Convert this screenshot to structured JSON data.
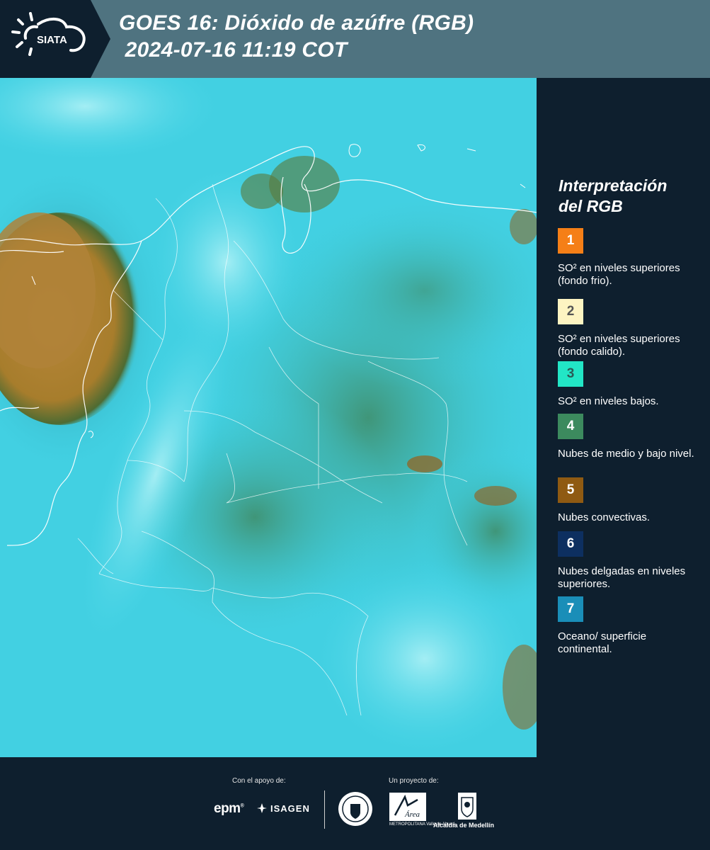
{
  "header": {
    "logo_text": "SIATA",
    "title_line1": "GOES 16: Dióxido de azúfre (RGB)",
    "title_line2": " 2024-07-16 11:19 COT"
  },
  "legend": {
    "title_line1": "Interpretación",
    "title_line2": "del RGB",
    "items": [
      {
        "number": "1",
        "color": "#f57f17",
        "number_color": "#ffffff",
        "label": "SO² en niveles superiores (fondo frio)."
      },
      {
        "number": "2",
        "color": "#fdf4c2",
        "number_color": "#555555",
        "label": "SO² en niveles superiores (fondo calido)."
      },
      {
        "number": "3",
        "color": "#22e6c6",
        "number_color": "#2b5a55",
        "label": "SO² en niveles bajos."
      },
      {
        "number": "4",
        "color": "#3c8a5e",
        "number_color": "#ffffff",
        "label": "Nubes de medio y bajo nivel."
      },
      {
        "number": "5",
        "color": "#8f5a12",
        "number_color": "#ffffff",
        "label": "Nubes convectivas."
      },
      {
        "number": "6",
        "color": "#0d2f60",
        "number_color": "#ffffff",
        "label": "Nubes delgadas en niveles superiores."
      },
      {
        "number": "7",
        "color": "#1a8eb8",
        "number_color": "#ffffff",
        "label": "Oceano/ superficie continental."
      }
    ]
  },
  "footer": {
    "support_label": "Con el apoyo de:",
    "project_label": "Un proyecto de:",
    "epm": "epm",
    "isagen": "ISAGEN",
    "amva_name": "Área",
    "amva_sub": "METROPOLITANA Valle de Aburrá",
    "alcaldia": "Alcaldía de Medellín"
  }
}
